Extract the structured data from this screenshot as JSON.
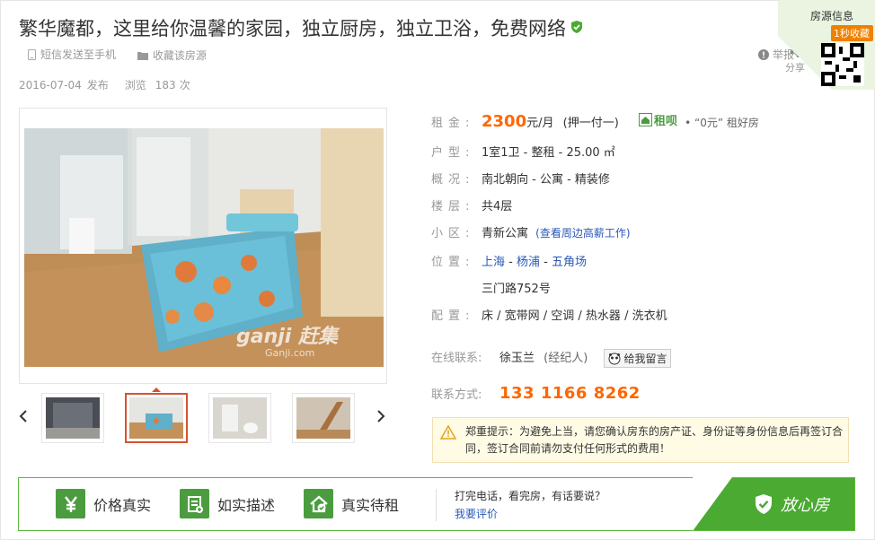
{
  "header": {
    "title": "繁华魔都，这里给你温馨的家园，独立厨房，独立卫浴，免费网络",
    "sms_label": "短信发送至手机",
    "fav_label": "收藏该房源",
    "report_label": "举报",
    "share_label": "分享"
  },
  "qr": {
    "label": "房源信息",
    "badge": "1秒收藏"
  },
  "meta": {
    "date": "2016-07-04",
    "posted": "发布",
    "views_label": "浏览",
    "views": "183",
    "views_unit": "次"
  },
  "photo": {
    "watermark_brand": "ganji 赶集",
    "watermark_url": "Ganji.com"
  },
  "thumbnails": {
    "prev_icon": "chevron-left-icon",
    "next_icon": "chevron-right-icon",
    "active_index": 1
  },
  "details": {
    "rent_label": "租金:",
    "rent_value": "2300",
    "rent_unit": "元/月",
    "rent_deposit": "(押一付一)",
    "zufen_label": "租呗",
    "zufen_desc": "“0元” 租好房",
    "type_label": "户型:",
    "type_value": "1室1卫 - 整租 - 25.00 ㎡",
    "overview_label": "概况:",
    "overview_value": "南北朝向 - 公寓 - 精装修",
    "floor_label": "楼层:",
    "floor_value": "共4层",
    "community_label": "小区:",
    "community_value": "青新公寓",
    "community_link": "(查看周边高薪工作)",
    "location_label": "位置:",
    "location_city": "上海",
    "location_district": "杨浦",
    "location_area": "五角场",
    "location_sep": " - ",
    "address": "三门路752号",
    "facilities_label": "配置:",
    "facilities_value": "床 / 宽带网 / 空调 / 热水器 / 洗衣机",
    "contact_label": "在线联系:",
    "contact_name": "徐玉兰",
    "contact_role": "(经纪人)",
    "message_button": "给我留言",
    "phone_label": "联系方式:",
    "phone_value": "133 1166 8262"
  },
  "warning": {
    "text": "郑重提示：为避免上当，请您确认房东的房产证、身份证等身份信息后再签订合同，签订合同前请勿支付任何形式的费用！"
  },
  "bottom_bar": {
    "features": [
      "价格真实",
      "如实描述",
      "真实待租"
    ],
    "question": "打完电话，看完房，有话要说？",
    "eval_link": "我要评价",
    "relief_label": "放心房"
  },
  "colors": {
    "accent_orange": "#ff6600",
    "link_blue": "#2b59b7",
    "green": "#4baa31"
  }
}
